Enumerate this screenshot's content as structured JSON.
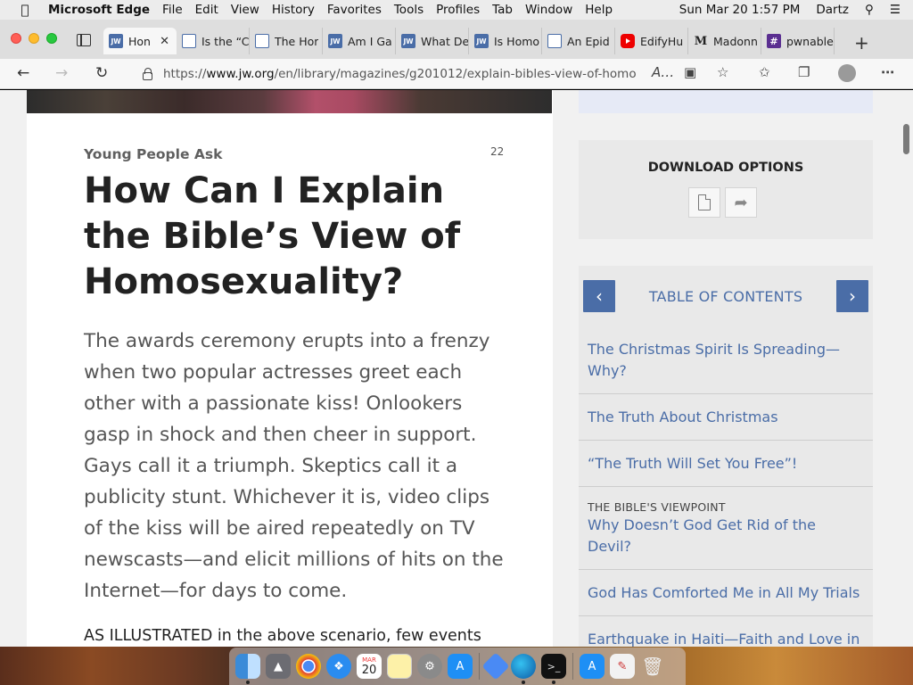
{
  "menubar": {
    "app_name": "Microsoft Edge",
    "menus": [
      "File",
      "Edit",
      "View",
      "History",
      "Favorites",
      "Tools",
      "Profiles",
      "Tab",
      "Window",
      "Help"
    ],
    "clock": "Sun Mar 20  1:57 PM",
    "user": "Dartz"
  },
  "browser": {
    "tabs": [
      {
        "title": "Hon",
        "favicon": "jw",
        "active": true
      },
      {
        "title": "Is the “C",
        "favicon": "doc"
      },
      {
        "title": "The Hor",
        "favicon": "doc"
      },
      {
        "title": "Am I Ga",
        "favicon": "jw"
      },
      {
        "title": "What De",
        "favicon": "jw"
      },
      {
        "title": "Is Homo",
        "favicon": "jw"
      },
      {
        "title": "An Epid",
        "favicon": "doc"
      },
      {
        "title": "EdifyHu",
        "favicon": "youtube"
      },
      {
        "title": "Madonn",
        "favicon": "m"
      },
      {
        "title": "pwnable",
        "favicon": "hash"
      }
    ],
    "address": {
      "prefix": "https://",
      "domain": "www.jw.org",
      "path": "/en/library/magazines/g201012/explain-bibles-view-of-homo..."
    }
  },
  "article": {
    "kicker": "Young People Ask",
    "page_number": "22",
    "headline": "How Can I Explain the Bible’s View of Homosexuality?",
    "lead": "The awards ceremony erupts into a frenzy when two popular actresses greet each other with a passionate kiss! Onlookers gasp in shock and then cheer in support. Gays call it a triumph. Skeptics call it a publicity stunt. Whichever it is, video clips of the kiss will be aired repeatedly on TV newscasts—and elicit millions of hits on the Internet—for days to come.",
    "body_start": "AS ILLUSTRATED in the above scenario, few events"
  },
  "sidebar": {
    "download_title": "DOWNLOAD OPTIONS",
    "toc_title": "TABLE OF CONTENTS",
    "toc_items": [
      {
        "label": "The Christmas Spirit Is Spreading—Why?"
      },
      {
        "label": "The Truth About Christmas"
      },
      {
        "label": "“The Truth Will Set You Free”!"
      },
      {
        "pre": "THE BIBLE'S VIEWPOINT",
        "label": "Why Doesn’t God Get Rid of the Devil?"
      },
      {
        "label": "God Has Comforted Me in All My Trials"
      },
      {
        "label": "Earthquake in Haiti—Faith and Love in Action"
      }
    ]
  },
  "dock": {
    "calendar_day": "20",
    "calendar_month": "MAR"
  },
  "colors": {
    "accent": "#4a6da7",
    "panel": "#e9e9e9"
  }
}
